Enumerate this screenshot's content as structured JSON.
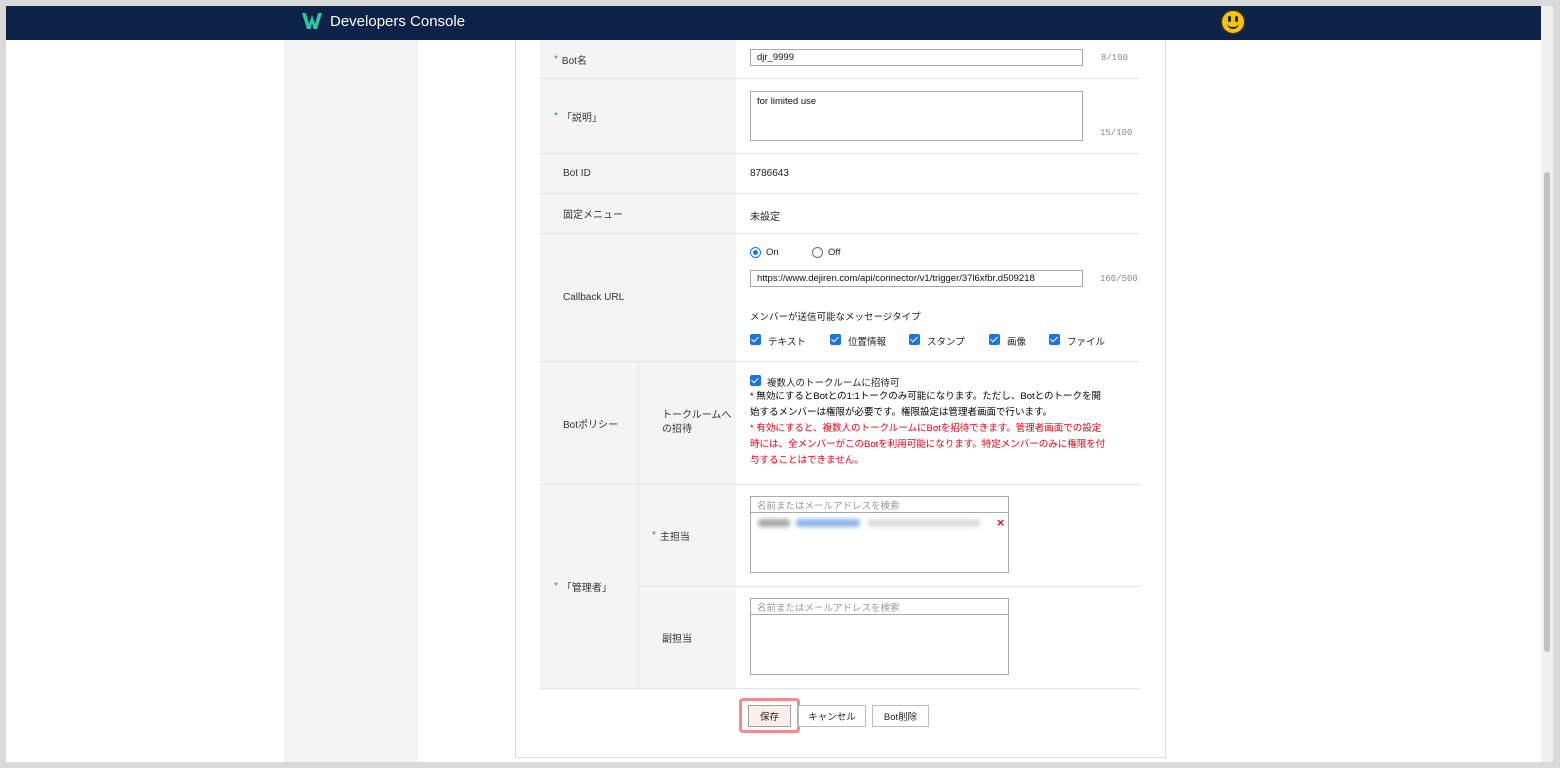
{
  "header": {
    "title": "Developers Console"
  },
  "form": {
    "bot_name": {
      "label": "Bot名",
      "value": "djr_9999",
      "counter": "8/100"
    },
    "description": {
      "label": "「説明」",
      "value": "for limited use",
      "counter": "15/100"
    },
    "bot_id": {
      "label": "Bot ID",
      "value": "8786643"
    },
    "fixed_menu": {
      "label": "固定メニュー",
      "value": "未設定"
    },
    "callback": {
      "label": "Callback URL",
      "on_label": "On",
      "off_label": "Off",
      "url": "https://www.dejiren.com/api/connector/v1/trigger/37l6xfbr.d509218",
      "counter": "160/500",
      "msg_types_label": "メンバーが送信可能なメッセージタイプ",
      "types": [
        "テキスト",
        "位置情報",
        "スタンプ",
        "画像",
        "ファイル"
      ]
    },
    "policy": {
      "label": "Botポリシー",
      "sub_label_1": "トークルームへ",
      "sub_label_2": "の招待",
      "checkbox_label": "複数人のトークルームに招待可",
      "note_1": "* 無効にするとBotとの1:1トークのみ可能になります。ただし、Botとのトークを開",
      "note_2": "始するメンバーは権限が必要です。権限設定は管理者画面で行います。",
      "warn_1": "* 有効にすると、複数人のトークルームにBotを招待できます。管理者画面での設定",
      "warn_2": "時には、全メンバーがこのBotを利用可能になります。特定メンバーのみに権限を付",
      "warn_3": "与することはできません。"
    },
    "admin": {
      "label": "「管理者」",
      "main_label": "主担当",
      "sub_label": "副担当",
      "search_placeholder": "名前またはメールアドレスを検索"
    }
  },
  "actions": {
    "save": "保存",
    "cancel": "キャンセル",
    "delete": "Bot削除"
  },
  "colors": {
    "header_bg": "#0c2249",
    "accent": "#1a73e8",
    "warning": "#e60012",
    "required": "#2aa52a"
  }
}
